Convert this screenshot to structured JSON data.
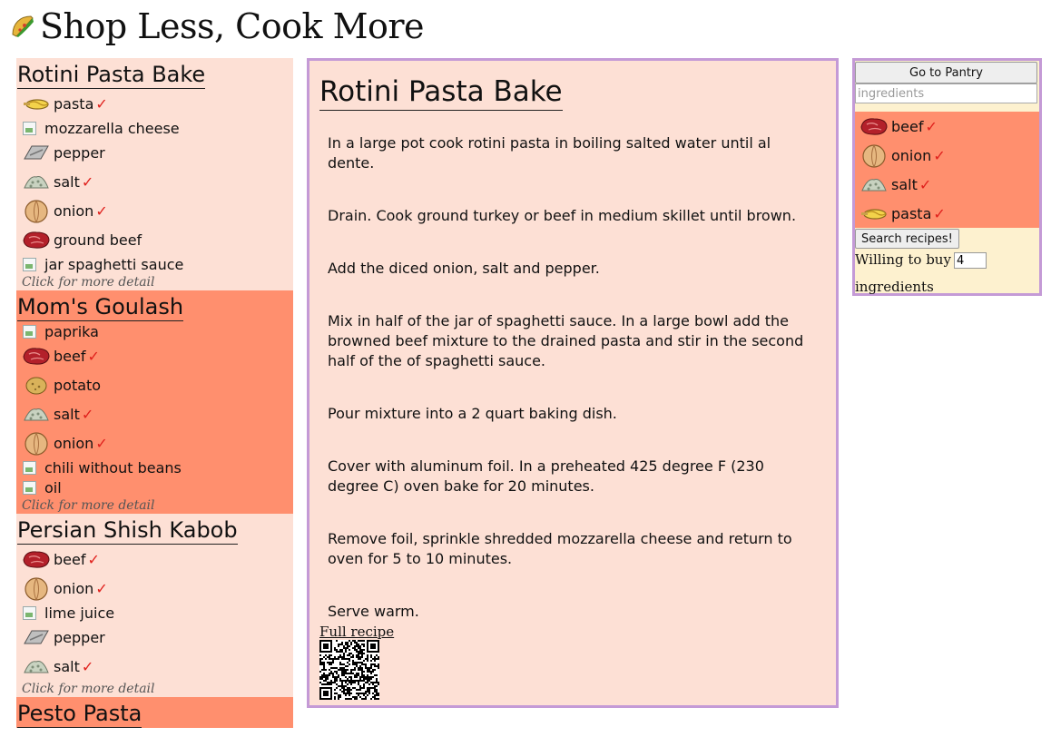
{
  "header": {
    "title": "Shop Less, Cook More",
    "logo_icon": "taco-icon"
  },
  "recipes": [
    {
      "title": "Rotini Pasta Bake",
      "ingredients": [
        {
          "name": "pasta",
          "icon": "pasta-icon",
          "check": "✓"
        },
        {
          "name": "mozzarella cheese",
          "icon": "broken-image-icon",
          "check": ""
        },
        {
          "name": "pepper",
          "icon": "pepper-icon",
          "check": ""
        },
        {
          "name": "salt",
          "icon": "salt-icon",
          "check": "✓"
        },
        {
          "name": "onion",
          "icon": "onion-icon",
          "check": "✓"
        },
        {
          "name": "ground beef",
          "icon": "beef-icon",
          "check": ""
        },
        {
          "name": "jar spaghetti sauce",
          "icon": "broken-image-icon",
          "check": ""
        }
      ],
      "more": "Click for more detail"
    },
    {
      "title": "Mom's Goulash",
      "ingredients": [
        {
          "name": "paprika",
          "icon": "broken-image-icon",
          "check": ""
        },
        {
          "name": "beef",
          "icon": "beef-icon",
          "check": "✓"
        },
        {
          "name": "potato",
          "icon": "potato-icon",
          "check": ""
        },
        {
          "name": "salt",
          "icon": "salt-icon",
          "check": "✓"
        },
        {
          "name": "onion",
          "icon": "onion-icon",
          "check": "✓"
        },
        {
          "name": "chili without beans",
          "icon": "broken-image-icon",
          "check": ""
        },
        {
          "name": "oil",
          "icon": "broken-image-icon",
          "check": ""
        }
      ],
      "more": "Click for more detail"
    },
    {
      "title": "Persian Shish Kabob",
      "ingredients": [
        {
          "name": "beef",
          "icon": "beef-icon",
          "check": "✓"
        },
        {
          "name": "onion",
          "icon": "onion-icon",
          "check": "✓"
        },
        {
          "name": "lime juice",
          "icon": "broken-image-icon",
          "check": ""
        },
        {
          "name": "pepper",
          "icon": "pepper-icon",
          "check": ""
        },
        {
          "name": "salt",
          "icon": "salt-icon",
          "check": "✓"
        }
      ],
      "more": "Click for more detail"
    },
    {
      "title": "Pesto Pasta",
      "ingredients": [],
      "more": ""
    }
  ],
  "detail": {
    "title": "Rotini Pasta Bake",
    "steps": [
      "In a large pot cook rotini pasta in boiling salted water until al dente.",
      "Drain. Cook ground turkey or beef in medium skillet until brown.",
      "Add the diced onion, salt and pepper.",
      "Mix in half of the jar of spaghetti sauce. In a large bowl add the browned beef mixture to the drained pasta and stir in the second half of the of spaghetti sauce.",
      "Pour mixture into a 2 quart baking dish.",
      "Cover with aluminum foil. In a preheated 425 degree F (230 degree C) oven bake for 20 minutes.",
      "Remove foil, sprinkle shredded mozzarella cheese and return to oven for 5 to 10 minutes.",
      "Serve warm."
    ],
    "full_recipe_label": "Full recipe",
    "qr_icon": "qr-code-icon"
  },
  "pantry": {
    "go_label": "Go to Pantry",
    "search_placeholder": "ingredients",
    "items": [
      {
        "name": "beef",
        "icon": "beef-icon",
        "check": "✓"
      },
      {
        "name": "onion",
        "icon": "onion-icon",
        "check": "✓"
      },
      {
        "name": "salt",
        "icon": "salt-icon",
        "check": "✓"
      },
      {
        "name": "pasta",
        "icon": "pasta-icon",
        "check": "✓"
      }
    ],
    "search_button": "Search recipes!",
    "willing_label": "Willing to buy",
    "willing_value": "4",
    "ingredients_label": "ingredients"
  },
  "colors": {
    "card_light": "#fde0d5",
    "card_dark": "#ff8f6e",
    "panel_border": "#c49ad6",
    "pantry_bg": "#fdf1cf",
    "check": "#e0201c"
  }
}
